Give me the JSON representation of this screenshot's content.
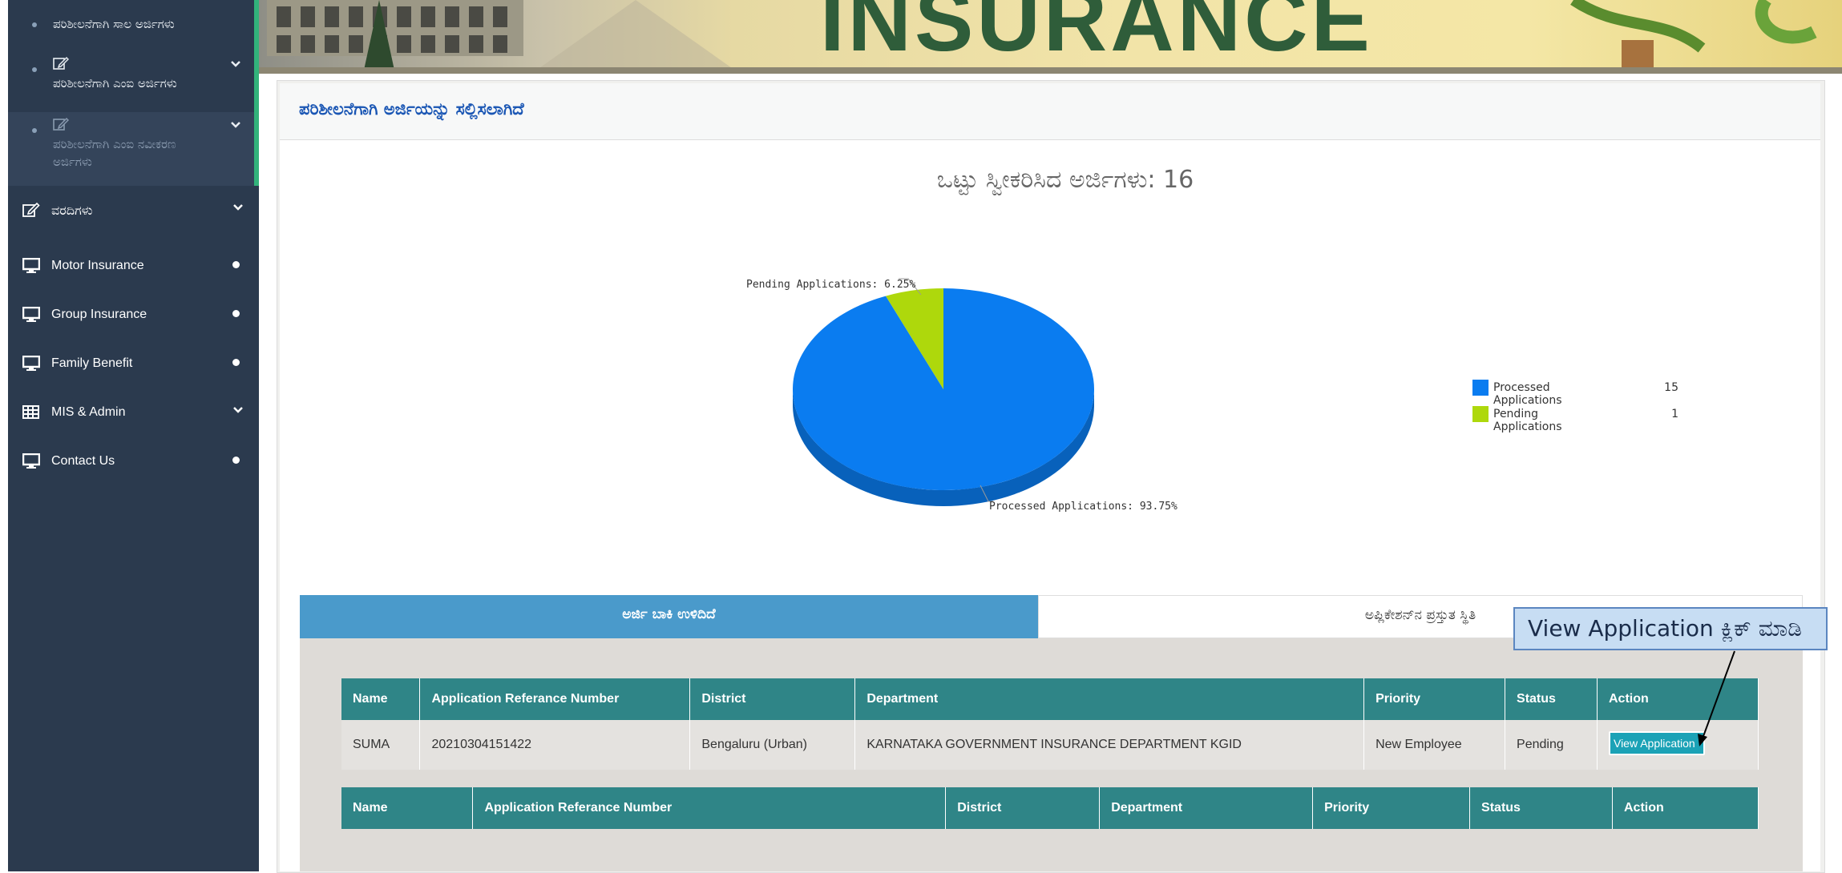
{
  "sidebar": {
    "sub_items": [
      {
        "label": "ಪರಿಶೀಲನೆಗಾಗಿ ಸಾಲ ಅರ್ಜಿಗಳು"
      },
      {
        "label": "ಪರಿಶೀಲನೆಗಾಗಿ ಎಂಐ ಅರ್ಜಿಗಳು"
      },
      {
        "label_line1": "ಪರಿಶೀಲನೆಗಾಗಿ ಎಂಐ ನವೀಕರಣ",
        "label_line2": "ಅರ್ಜಿಗಳು"
      }
    ],
    "nav": [
      {
        "label": "ವರದಿಗಳು",
        "icon": "edit-icon",
        "right": "chevron-down"
      },
      {
        "label": "Motor Insurance",
        "icon": "monitor-icon",
        "right": "bullet"
      },
      {
        "label": "Group Insurance",
        "icon": "monitor-icon",
        "right": "bullet"
      },
      {
        "label": "Family Benefit",
        "icon": "monitor-icon",
        "right": "bullet"
      },
      {
        "label": "MIS & Admin",
        "icon": "grid-icon",
        "right": "chevron-down"
      },
      {
        "label": "Contact Us",
        "icon": "monitor-icon",
        "right": "bullet"
      }
    ]
  },
  "banner": {
    "text": "INSURANCE"
  },
  "panel": {
    "title": "ಪರಿಶೀಲನೆಗಾಗಿ ಅರ್ಜಿಯನ್ನು ಸಲ್ಲಿಸಲಾಗಿದೆ"
  },
  "chart_data": {
    "type": "pie",
    "title": "ಒಟ್ಟು ಸ್ವೀಕರಿಸಿದ ಅರ್ಜಿಗಳು: 16",
    "slices": [
      {
        "name": "Processed Applications",
        "value": 15,
        "percent_label": "Processed Applications: 93.75%",
        "color": "#0a7cf0"
      },
      {
        "name": "Pending Applications",
        "value": 1,
        "percent_label": "Pending Applications: 6.25%",
        "color": "#aed80c"
      }
    ],
    "legend_position": "right"
  },
  "tabs": {
    "pending": "ಅರ್ಜಿ ಬಾಕಿ ಉಳಿದಿದೆ",
    "status": "ಅಪ್ಲಿಕೇಶನ್‌ನ ಪ್ರಸ್ತುತ ಸ್ಥಿತಿ"
  },
  "table1": {
    "headers": [
      "Name",
      "Application Referance Number",
      "District",
      "Department",
      "Priority",
      "Status",
      "Action"
    ],
    "row": {
      "name": "SUMA",
      "ref": "20210304151422",
      "district": "Bengaluru (Urban)",
      "department": "KARNATAKA GOVERNMENT INSURANCE DEPARTMENT KGID",
      "priority": "New Employee",
      "status": "Pending",
      "action": "View Application"
    }
  },
  "table2": {
    "headers": [
      "Name",
      "Application Referance Number",
      "District",
      "Department",
      "Priority",
      "Status",
      "Action"
    ]
  },
  "callout": {
    "text": "View Application ಕ್ಲಿಕ್ ಮಾಡಿ"
  }
}
